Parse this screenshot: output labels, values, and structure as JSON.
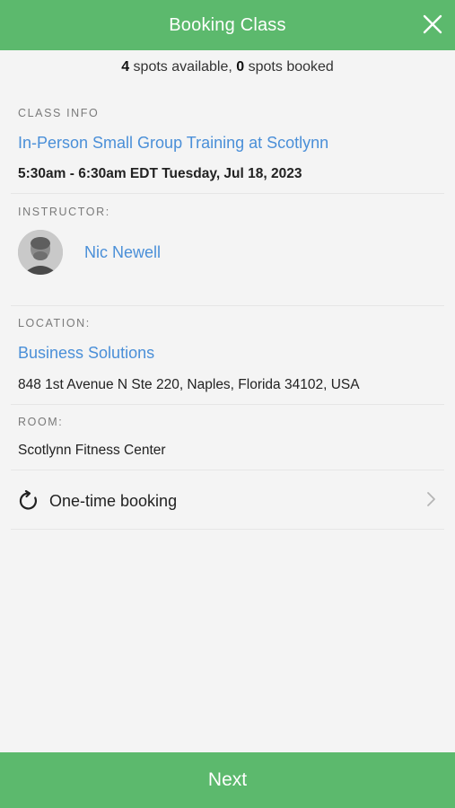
{
  "header": {
    "title": "Booking Class"
  },
  "spots": {
    "available_count": "4",
    "available_text": " spots available, ",
    "booked_count": "0",
    "booked_text": " spots booked"
  },
  "class_info": {
    "label": "CLASS INFO",
    "name": "In-Person Small Group Training at Scotlynn",
    "datetime": "5:30am - 6:30am EDT Tuesday, Jul 18, 2023"
  },
  "instructor": {
    "label": "INSTRUCTOR:",
    "name": "Nic Newell"
  },
  "location": {
    "label": "LOCATION:",
    "name": "Business Solutions",
    "address": "848 1st Avenue N Ste 220, Naples, Florida 34102, USA"
  },
  "room": {
    "label": "ROOM:",
    "name": "Scotlynn Fitness Center"
  },
  "booking": {
    "label": "One-time booking"
  },
  "footer": {
    "next_label": "Next"
  },
  "colors": {
    "brand_green": "#5cb96d",
    "link_blue": "#4a8fd8",
    "background": "#f4f4f4"
  }
}
